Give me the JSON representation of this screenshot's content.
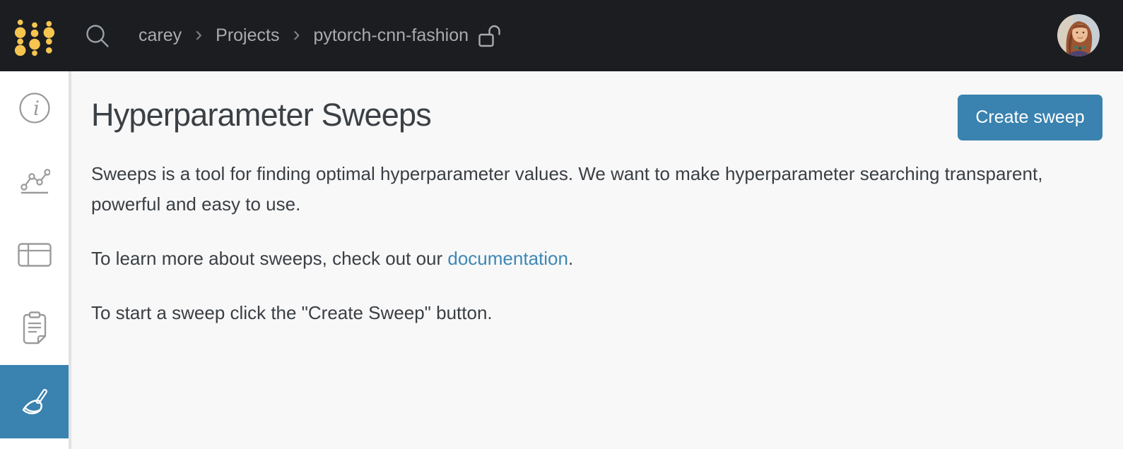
{
  "nav": {
    "logo_icon": "wandb-dots-logo",
    "search_icon": "search-icon",
    "breadcrumb": {
      "separator": "›",
      "items": [
        {
          "label": "carey"
        },
        {
          "label": "Projects"
        },
        {
          "label": "pytorch-cnn-fashion"
        }
      ]
    },
    "visibility_icon": "unlock-icon",
    "avatar": "user-avatar"
  },
  "sidebar": {
    "items": [
      {
        "icon": "info-icon",
        "selected": false
      },
      {
        "icon": "line-chart-icon",
        "selected": false
      },
      {
        "icon": "table-icon",
        "selected": false
      },
      {
        "icon": "clipboard-icon",
        "selected": false
      },
      {
        "icon": "broom-icon",
        "selected": true
      }
    ]
  },
  "main": {
    "title": "Hyperparameter Sweeps",
    "create_button_label": "Create sweep",
    "paragraphs": {
      "p1": "Sweeps is a tool for finding optimal hyperparameter values. We want to make hyperparameter searching transparent, powerful and easy to use.",
      "p2_before": "To learn more about sweeps, check out our ",
      "p2_link": "documentation",
      "p2_after": ".",
      "p3": "To start a sweep click the \"Create Sweep\" button."
    }
  },
  "colors": {
    "nav_bg": "#1b1d21",
    "logo_gold": "#f6c550",
    "accent_blue": "#3a82af",
    "link_blue": "#3e87b5",
    "main_bg": "#f8f8f8",
    "text": "#3a3f44",
    "breadcrumb_text": "#a9abae"
  }
}
